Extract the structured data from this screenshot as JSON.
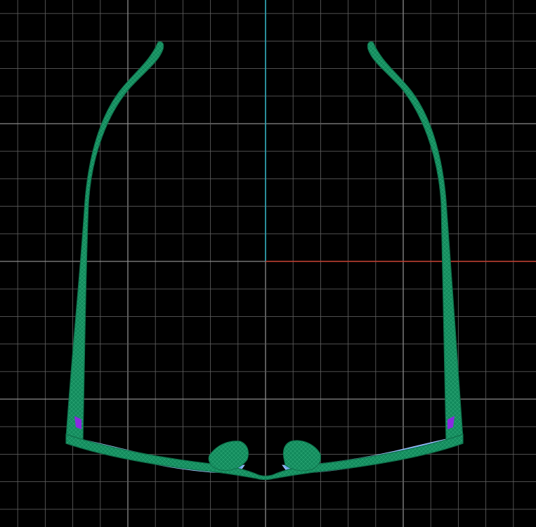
{
  "viewport": {
    "background": "#000000",
    "grid_color": "#5a5a5a",
    "major_grid_color": "#8a8a8a",
    "axis_x_color": "#c0392b",
    "axis_y_color": "#2aa8b8",
    "model": {
      "name": "sunglasses-wireframe",
      "frame_color": "#128a5c",
      "wire_color": "#47c48e",
      "lens_color": "#6ea8f0",
      "hinge_color": "#8a2be2"
    }
  }
}
